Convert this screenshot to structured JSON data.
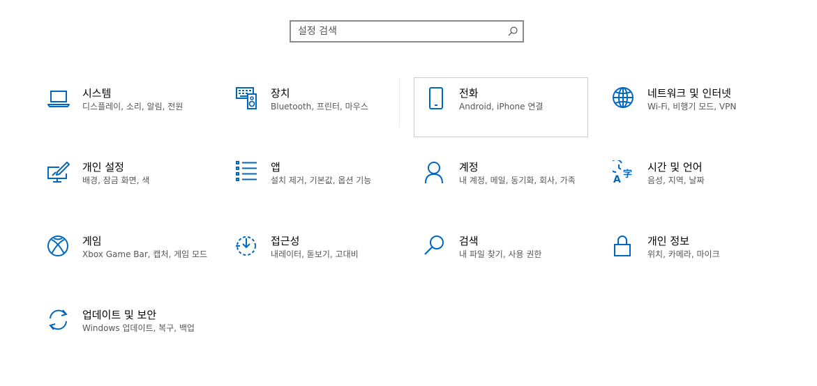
{
  "search": {
    "placeholder": "설정 검색"
  },
  "accent_color": "#0067c0",
  "tiles": [
    {
      "icon": "laptop-icon",
      "title": "시스템",
      "subtitle": "디스플레이, 소리, 알림, 전원"
    },
    {
      "icon": "keyboard-speaker-icon",
      "title": "장치",
      "subtitle": "Bluetooth, 프린터, 마우스"
    },
    {
      "icon": "phone-icon",
      "title": "전화",
      "subtitle": "Android, iPhone 연결"
    },
    {
      "icon": "globe-icon",
      "title": "네트워크 및 인터넷",
      "subtitle": "Wi-Fi, 비행기 모드, VPN"
    },
    {
      "icon": "personalization-icon",
      "title": "개인 설정",
      "subtitle": "배경, 잠금 화면, 색"
    },
    {
      "icon": "apps-list-icon",
      "title": "앱",
      "subtitle": "설치 제거, 기본값, 옵션 기능"
    },
    {
      "icon": "person-icon",
      "title": "계정",
      "subtitle": "내 계정, 메일, 동기화, 회사, 가족"
    },
    {
      "icon": "time-language-icon",
      "title": "시간 및 언어",
      "subtitle": "음성, 지역, 날짜"
    },
    {
      "icon": "xbox-icon",
      "title": "게임",
      "subtitle": "Xbox Game Bar, 캡처, 게임 모드"
    },
    {
      "icon": "ease-of-access-icon",
      "title": "접근성",
      "subtitle": "내레이터, 돋보기, 고대비"
    },
    {
      "icon": "search-magnifier-icon",
      "title": "검색",
      "subtitle": "내 파일 찾기, 사용 권한"
    },
    {
      "icon": "lock-icon",
      "title": "개인 정보",
      "subtitle": "위치, 카메라, 마이크"
    },
    {
      "icon": "update-sync-icon",
      "title": "업데이트 및 보안",
      "subtitle": "Windows 업데이트, 복구, 백업"
    }
  ]
}
